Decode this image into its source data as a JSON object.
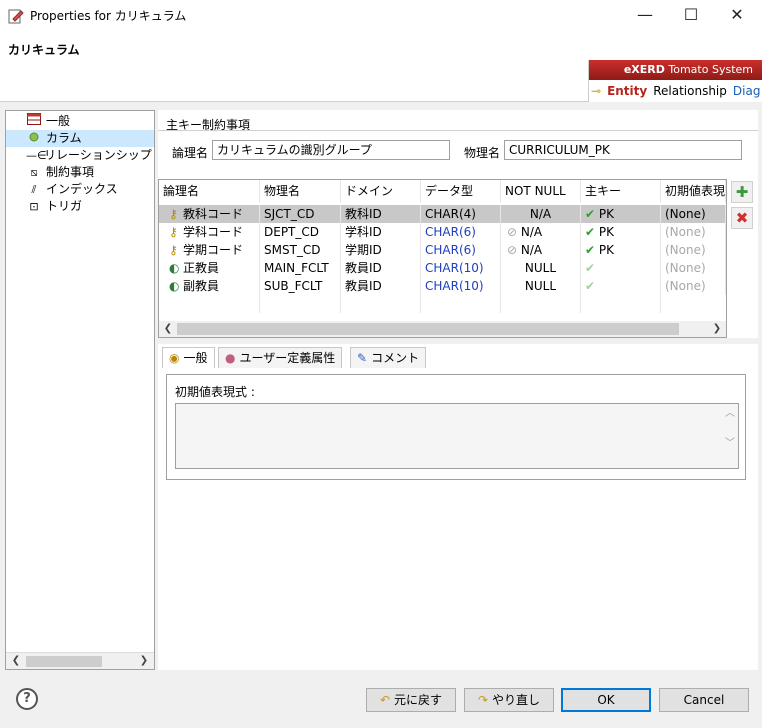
{
  "window": {
    "title": "Properties for カリキュラム",
    "minimize": "—",
    "maximize": "☐",
    "close": "✕"
  },
  "header": {
    "title": "カリキュラム",
    "brand": "eXERD",
    "brand_sub": "Tomato System",
    "tabs": [
      "Entity",
      "Relationship",
      "Diag"
    ]
  },
  "tree": {
    "items": [
      {
        "label": "一般",
        "icon": "table-icon"
      },
      {
        "label": "カラム",
        "icon": "column-dot-icon"
      },
      {
        "label": "リレーションシップ",
        "icon": "relationship-icon"
      },
      {
        "label": "制約事項",
        "icon": "constraint-icon"
      },
      {
        "label": "インデックス",
        "icon": "index-icon"
      },
      {
        "label": "トリガ",
        "icon": "trigger-icon"
      }
    ]
  },
  "pk": {
    "group_title": "主キー制約事項",
    "logical_label": "論理名",
    "logical_value": "カリキュラムの識別グループ",
    "physical_label": "物理名",
    "physical_value": "CURRICULUM_PK"
  },
  "grid": {
    "columns": [
      "論理名",
      "物理名",
      "ドメイン",
      "データ型",
      "NOT NULL",
      "主キー",
      "初期値表現"
    ],
    "rows": [
      {
        "logical": "教科コード",
        "physical": "SJCT_CD",
        "domain": "教科ID",
        "type": "CHAR(4)",
        "notnull": "N/A",
        "pk": "PK",
        "init": "(None)",
        "pk_on": true,
        "selected": true
      },
      {
        "logical": "学科コード",
        "physical": "DEPT_CD",
        "domain": "学科ID",
        "type": "CHAR(6)",
        "notnull": "N/A",
        "pk": "PK",
        "init": "(None)",
        "pk_on": true,
        "selected": false
      },
      {
        "logical": "学期コード",
        "physical": "SMST_CD",
        "domain": "学期ID",
        "type": "CHAR(6)",
        "notnull": "N/A",
        "pk": "PK",
        "init": "(None)",
        "pk_on": true,
        "selected": false
      },
      {
        "logical": "正教員",
        "physical": "MAIN_FCLT",
        "domain": "教員ID",
        "type": "CHAR(10)",
        "notnull": "NULL",
        "pk": "",
        "init": "(None)",
        "pk_on": false,
        "selected": false
      },
      {
        "logical": "副教員",
        "physical": "SUB_FCLT",
        "domain": "教員ID",
        "type": "CHAR(10)",
        "notnull": "NULL",
        "pk": "",
        "init": "(None)",
        "pk_on": false,
        "selected": false
      }
    ]
  },
  "lower_tabs": [
    {
      "label": "一般",
      "icon": "general-icon"
    },
    {
      "label": "ユーザー定義属性",
      "icon": "user-attr-icon"
    },
    {
      "label": "コメント",
      "icon": "comment-icon"
    }
  ],
  "init_expr_label": "初期値表現式 :",
  "buttons": {
    "help": "?",
    "undo": "元に戻す",
    "redo": "やり直し",
    "ok": "OK",
    "cancel": "Cancel"
  }
}
